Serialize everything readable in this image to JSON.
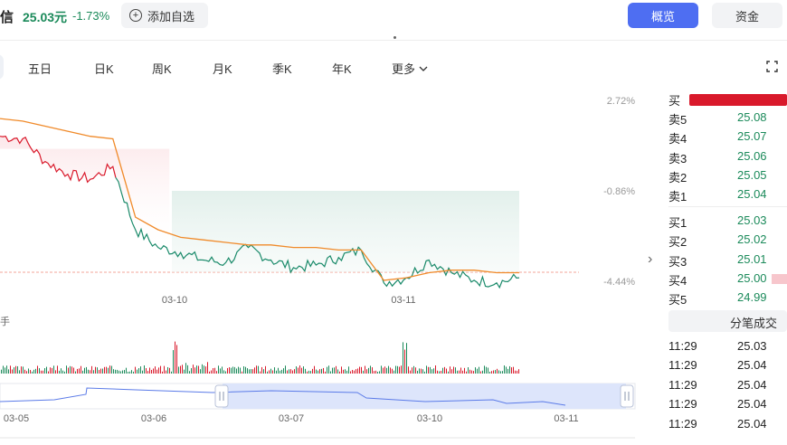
{
  "header": {
    "stock_name": "信",
    "price": "25.03元",
    "change_pct": "-1.73%",
    "add_watchlist": "添加自选",
    "tab_overview": "概览",
    "tab_funds": "资金"
  },
  "period_tabs": [
    "五日",
    "日K",
    "周K",
    "月K",
    "季K",
    "年K",
    "更多"
  ],
  "fullscreen_label": "",
  "chart_data": {
    "type": "line",
    "right_axis_ticks": [
      "2.72%",
      "-0.86%",
      "-4.44%"
    ],
    "x_labels": [
      "03-10",
      "03-11"
    ],
    "volume_unit": "手",
    "navigator_labels": [
      "03-05",
      "03-06",
      "03-07",
      "03-10",
      "03-11"
    ],
    "series": [
      {
        "color": "#1a8a6a",
        "values": [
          1.3,
          1.2,
          0.3,
          -0.2,
          -0.4,
          0.1,
          -2.4,
          -3.1,
          -3.3,
          -3.6,
          -3.7,
          -3.1,
          -3.6,
          -3.9,
          -3.8,
          -3.5,
          -3.2,
          -4.5,
          -4.3,
          -3.6,
          -4.1,
          -4.4,
          -4.5,
          -4.3
        ]
      },
      {
        "color": "#f08a2a",
        "values": [
          2.0,
          1.9,
          1.7,
          1.5,
          1.3,
          1.2,
          -1.9,
          -2.4,
          -2.7,
          -2.8,
          -2.9,
          -3.0,
          -3.0,
          -3.1,
          -3.1,
          -3.2,
          -3.2,
          -4.4,
          -4.3,
          -4.1,
          -4.0,
          -4.0,
          -4.1,
          -4.1
        ]
      }
    ],
    "reference_line_pct": -4.44
  },
  "order_book": {
    "buy_top_label": "买",
    "asks": [
      {
        "label": "卖5",
        "price": "25.08"
      },
      {
        "label": "卖4",
        "price": "25.07"
      },
      {
        "label": "卖3",
        "price": "25.06"
      },
      {
        "label": "卖2",
        "price": "25.05"
      },
      {
        "label": "卖1",
        "price": "25.04"
      }
    ],
    "bids": [
      {
        "label": "买1",
        "price": "25.03"
      },
      {
        "label": "买2",
        "price": "25.02"
      },
      {
        "label": "买3",
        "price": "25.01"
      },
      {
        "label": "买4",
        "price": "25.00"
      },
      {
        "label": "买5",
        "price": "24.99"
      }
    ]
  },
  "trades": {
    "title": "分笔成交",
    "rows": [
      {
        "time": "11:29",
        "price": "25.03"
      },
      {
        "time": "11:29",
        "price": "25.04"
      },
      {
        "time": "11:29",
        "price": "25.04"
      },
      {
        "time": "11:29",
        "price": "25.04"
      },
      {
        "time": "11:29",
        "price": "25.04"
      }
    ]
  },
  "colors": {
    "accent": "#4e6ef2",
    "down": "#1b8a5a",
    "up": "#d9192b",
    "avg_line": "#f08a2a"
  }
}
